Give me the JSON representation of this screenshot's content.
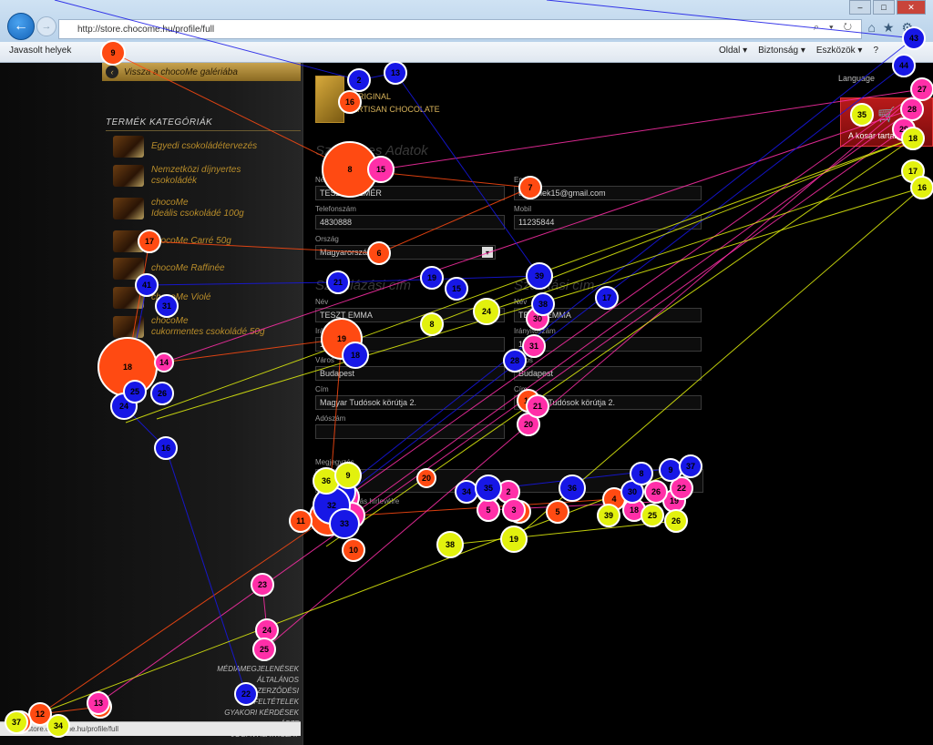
{
  "browser": {
    "url": "http://store.chocome.hu/profile/full",
    "address_controls": "⌕ ▾ ↻",
    "favorites_label": "Javasolt helyek",
    "menu": {
      "page": "Oldal ▾",
      "safety": "Biztonság ▾",
      "tools": "Eszközök ▾",
      "help": "?"
    }
  },
  "sidebar": {
    "back_label": "Vissza a chocoMe galériába",
    "categories_title": "TERMÉK KATEGÓRIÁK",
    "categories": [
      {
        "line1": "Egyedi csokoládétervezés",
        "line2": ""
      },
      {
        "line1": "Nemzetközi díjnyertes",
        "line2": "csokoládék"
      },
      {
        "line1": "chocoMe",
        "line2": "Ideális csokoládé 100g"
      },
      {
        "line1": "chocoMe Carré 50g",
        "line2": ""
      },
      {
        "line1": "chocoMe Raffinée",
        "line2": ""
      },
      {
        "line1": "chocoMe Violé",
        "line2": ""
      },
      {
        "line1": "chocoMe",
        "line2": "cukormentes csokoládé 50g"
      }
    ],
    "footer_links": [
      "MÉDIAMEGJELENÉSEK",
      "ÁLTALÁNOS SZERZŐDÉSI",
      "FELTÉTELEK",
      "GYAKORI KÉRDÉSEK",
      "ÁSZF",
      "JOGI NYILATKOZAT"
    ]
  },
  "header": {
    "brand_line1": "ORIGINAL",
    "brand_line2": "ARTISAN CHOCOLATE",
    "language_link": "Language",
    "cart_label": "A kosár tartalma"
  },
  "form": {
    "personal_title": "Személyes Adatok",
    "personal": {
      "name_label": "Név",
      "name_value": "TESZT ELEMÉR",
      "email_label": "Email",
      "email_value": "tesztelek15@gmail.com",
      "phone_label": "Telefonszám",
      "phone_value": "4830888",
      "mobile_label": "Mobil",
      "mobile_value": "11235844",
      "country_label": "Ország",
      "country_value": "Magyarország"
    },
    "billing_title": "Számlázási cím",
    "shipping_title": "Szállítási cím",
    "billing": {
      "name_label": "Név",
      "name_value": "TESZT EMMA",
      "zip_label": "Irányítószám",
      "zip_value": "1117",
      "city_label": "Város",
      "city_value": "Budapest",
      "address_label": "Cím",
      "address_value": "Magyar Tudósok körútja 2.",
      "tax_label": "Adószám",
      "tax_value": ""
    },
    "shipping": {
      "name_label": "Név",
      "name_value": "TESZT EMMA",
      "zip_label": "Irányítószám",
      "zip_value": "1117",
      "city_label": "Város",
      "city_value": "Budapest",
      "address_label": "Cím",
      "address_value": "Magyar Tudósok körútja 2."
    },
    "comment_label": "Megjegyzés",
    "newsletter_label": "Feliratkozás hírlevélre"
  },
  "status_bar": {
    "url": "store.chocome.hu/profile/full"
  },
  "gaze_overlay": {
    "colors": {
      "red": "#ff4a12",
      "pink": "#ff2fa8",
      "blue": "#1717e6",
      "yellow": "#e2f10e"
    },
    "fixations": [
      {
        "label": "9",
        "color": "red"
      },
      {
        "label": "16",
        "color": "red"
      },
      {
        "label": "8",
        "color": "red"
      },
      {
        "label": "7",
        "color": "red"
      },
      {
        "label": "6",
        "color": "red"
      },
      {
        "label": "17",
        "color": "red"
      },
      {
        "label": "18",
        "color": "red"
      },
      {
        "label": "19",
        "color": "red"
      },
      {
        "label": "1",
        "color": "red"
      },
      {
        "label": "2",
        "color": "red"
      },
      {
        "label": "3",
        "color": "red"
      },
      {
        "label": "4",
        "color": "red"
      },
      {
        "label": "5",
        "color": "red"
      },
      {
        "label": "10",
        "color": "red"
      },
      {
        "label": "11",
        "color": "red"
      },
      {
        "label": "12",
        "color": "red"
      },
      {
        "label": "13",
        "color": "red"
      },
      {
        "label": "14",
        "color": "red"
      },
      {
        "label": "15",
        "color": "red"
      },
      {
        "label": "20",
        "color": "red"
      },
      {
        "label": "14",
        "color": "pink"
      },
      {
        "label": "15",
        "color": "pink"
      },
      {
        "label": "23",
        "color": "pink"
      },
      {
        "label": "24",
        "color": "pink"
      },
      {
        "label": "25",
        "color": "pink"
      },
      {
        "label": "20",
        "color": "pink"
      },
      {
        "label": "21",
        "color": "pink"
      },
      {
        "label": "5",
        "color": "pink"
      },
      {
        "label": "18",
        "color": "pink"
      },
      {
        "label": "19",
        "color": "pink"
      },
      {
        "label": "13",
        "color": "pink"
      },
      {
        "label": "27",
        "color": "pink"
      },
      {
        "label": "28",
        "color": "pink"
      },
      {
        "label": "29",
        "color": "pink"
      },
      {
        "label": "11",
        "color": "pink"
      },
      {
        "label": "12",
        "color": "pink"
      },
      {
        "label": "2",
        "color": "pink"
      },
      {
        "label": "3",
        "color": "pink"
      },
      {
        "label": "22",
        "color": "pink"
      },
      {
        "label": "26",
        "color": "pink"
      },
      {
        "label": "30",
        "color": "pink"
      },
      {
        "label": "31",
        "color": "pink"
      },
      {
        "label": "43",
        "color": "blue"
      },
      {
        "label": "2",
        "color": "blue"
      },
      {
        "label": "44",
        "color": "blue"
      },
      {
        "label": "13",
        "color": "blue"
      },
      {
        "label": "41",
        "color": "blue"
      },
      {
        "label": "31",
        "color": "blue"
      },
      {
        "label": "21",
        "color": "blue"
      },
      {
        "label": "18",
        "color": "blue"
      },
      {
        "label": "19",
        "color": "blue"
      },
      {
        "label": "15",
        "color": "blue"
      },
      {
        "label": "39",
        "color": "blue"
      },
      {
        "label": "38",
        "color": "blue"
      },
      {
        "label": "17",
        "color": "blue"
      },
      {
        "label": "16",
        "color": "blue"
      },
      {
        "label": "22",
        "color": "blue"
      },
      {
        "label": "24",
        "color": "blue"
      },
      {
        "label": "25",
        "color": "blue"
      },
      {
        "label": "26",
        "color": "blue"
      },
      {
        "label": "28",
        "color": "blue"
      },
      {
        "label": "29",
        "color": "blue"
      },
      {
        "label": "32",
        "color": "blue"
      },
      {
        "label": "33",
        "color": "blue"
      },
      {
        "label": "34",
        "color": "blue"
      },
      {
        "label": "35",
        "color": "blue"
      },
      {
        "label": "36",
        "color": "blue"
      },
      {
        "label": "30",
        "color": "blue"
      },
      {
        "label": "8",
        "color": "blue"
      },
      {
        "label": "9",
        "color": "blue"
      },
      {
        "label": "37",
        "color": "blue"
      },
      {
        "label": "35",
        "color": "yellow"
      },
      {
        "label": "36",
        "color": "yellow"
      },
      {
        "label": "9",
        "color": "yellow"
      },
      {
        "label": "8",
        "color": "yellow"
      },
      {
        "label": "24",
        "color": "yellow"
      },
      {
        "label": "38",
        "color": "yellow"
      },
      {
        "label": "19",
        "color": "yellow"
      },
      {
        "label": "39",
        "color": "yellow"
      },
      {
        "label": "25",
        "color": "yellow"
      },
      {
        "label": "26",
        "color": "yellow"
      },
      {
        "label": "18",
        "color": "yellow"
      },
      {
        "label": "17",
        "color": "yellow"
      },
      {
        "label": "16",
        "color": "yellow"
      },
      {
        "label": "37",
        "color": "yellow"
      },
      {
        "label": "34",
        "color": "yellow"
      }
    ]
  }
}
